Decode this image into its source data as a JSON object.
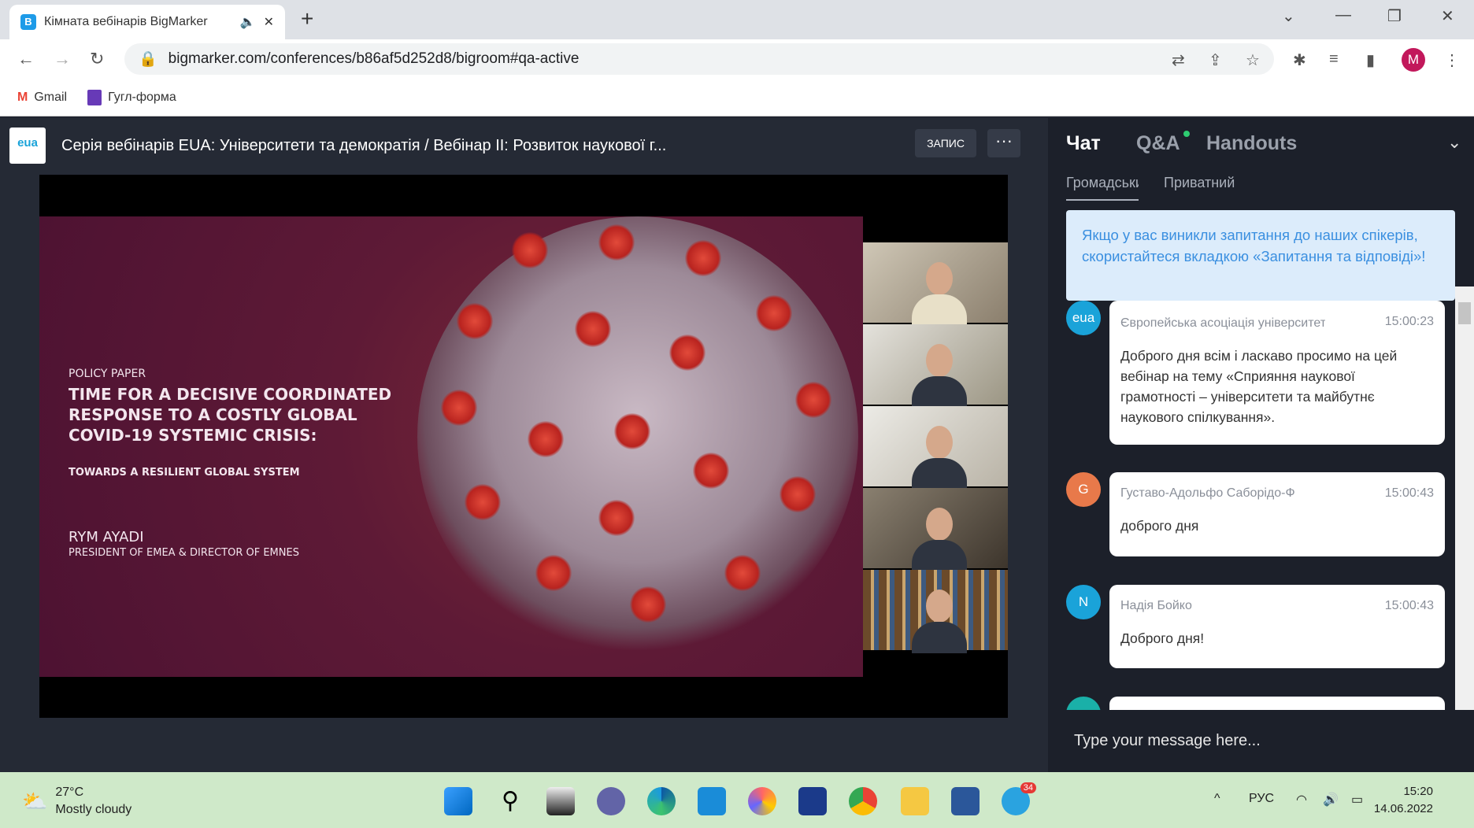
{
  "browser": {
    "tab_title": "Кімната вебінарів BigMarker",
    "url": "bigmarker.com/conferences/b86af5d252d8/bigroom#qa-active",
    "bookmarks": [
      "Gmail",
      "Гугл-форма"
    ],
    "profile_initial": "M"
  },
  "app": {
    "logo_text": "eua",
    "title": "Серія вебінарів EUA: Університети та демократія / Вебінар II: Розвиток наукової г...",
    "record_label": "ЗАПИС",
    "more_label": "···"
  },
  "slide": {
    "kicker": "POLICY PAPER",
    "title_lines": [
      "TIME FOR A DECISIVE COORDINATED",
      "RESPONSE TO A COSTLY GLOBAL",
      "COVID-19 SYSTEMIC CRISIS:"
    ],
    "subtitle": "TOWARDS A RESILIENT GLOBAL SYSTEM",
    "author": "RYM AYADI",
    "author_role": "PRESIDENT OF EMEA & DIRECTOR OF EMNES"
  },
  "panel": {
    "tabs": [
      "Чат",
      "Q&A",
      "Handouts"
    ],
    "subtabs": [
      "Громадський",
      "Приватний"
    ],
    "notice": "Якщо у вас виникли запитання до наших спікерів, скористайтеся вкладкою «Запитання та відповіді»!",
    "messages": [
      {
        "avatar": "eua",
        "color": "#1aa3d9",
        "name": "Європейська асоціація університетів ★",
        "time": "15:00:23",
        "text": "Доброго дня всім і ласкаво просимо на цей вебінар на тему «Сприяння наукової грамотності – університети та майбутнє наукового спілкування»."
      },
      {
        "avatar": "G",
        "color": "#e8794a",
        "name": "Густаво-Адольфо Саборідо-Ф",
        "time": "15:00:43",
        "text": "доброго дня"
      },
      {
        "avatar": "N",
        "color": "#1aa3d9",
        "name": "Надія Бойко",
        "time": "15:00:43",
        "text": "Доброго дня!"
      }
    ],
    "input_placeholder": "Type your message here..."
  },
  "taskbar": {
    "temperature": "27°C",
    "weather": "Mostly cloudy",
    "telegram_badge": "34",
    "language": "РУС",
    "time": "15:20",
    "date": "14.06.2022"
  }
}
